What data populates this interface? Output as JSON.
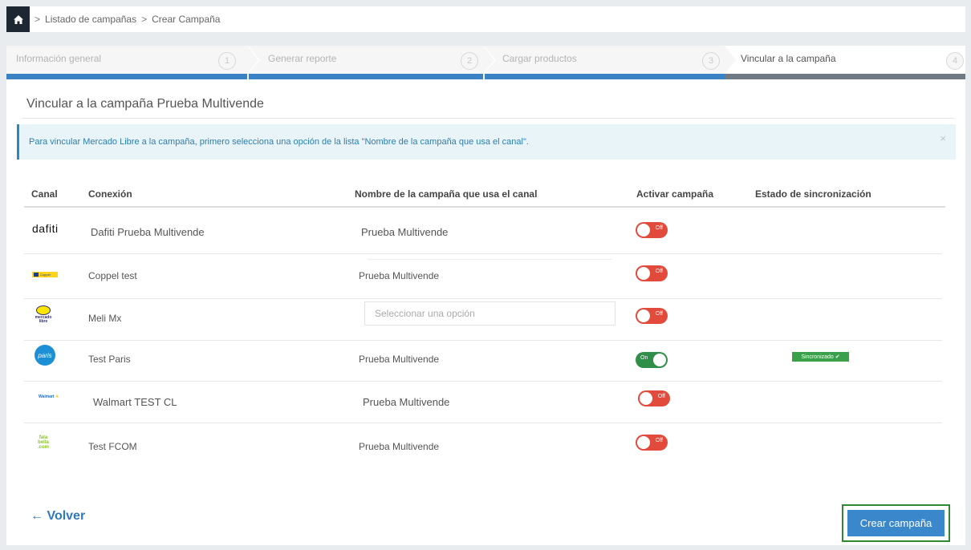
{
  "breadcrumb": {
    "items": [
      "Listado de campañas",
      "Crear Campaña"
    ],
    "separator": ">"
  },
  "stepper": {
    "steps": [
      {
        "label": "Información general",
        "num": "1"
      },
      {
        "label": "Generar reporte",
        "num": "2"
      },
      {
        "label": "Cargar productos",
        "num": "3"
      },
      {
        "label": "Vincular a la campaña",
        "num": "4"
      }
    ],
    "active_step": 4
  },
  "card": {
    "title": "Vincular a la campaña Prueba Multivende",
    "alert": "Para vincular Mercado Libre a la campaña, primero selecciona una opción de la lista \"Nombre de la campaña que usa el canal\".",
    "alert_close": "×"
  },
  "table": {
    "headers": [
      "Canal",
      "Conexión",
      "Nombre de la campaña que usa el canal",
      "Activar campaña",
      "Estado de sincronización"
    ],
    "rows": [
      {
        "logo_text": "dafiti",
        "conexion": "Dafiti Prueba Multivende",
        "campaign": "Prueba Multivende",
        "toggle": "Off",
        "sync": ""
      },
      {
        "logo_text": "Coppel",
        "conexion": "Coppel test",
        "campaign": "Prueba Multivende",
        "toggle": "Off",
        "sync": ""
      },
      {
        "logo_text": "mercado libre",
        "conexion": "Meli Mx",
        "campaign": "",
        "select_placeholder": "Seleccionar una opción",
        "toggle": "Off",
        "sync": ""
      },
      {
        "logo_text": "paris",
        "conexion": "Test Paris",
        "campaign": "Prueba Multivende",
        "toggle": "On",
        "sync": "Sincronizado ✔"
      },
      {
        "logo_text": "Walmart",
        "conexion": "Walmart TEST CL",
        "campaign": "Prueba Multivende",
        "toggle": "Off",
        "sync": ""
      },
      {
        "logo_text": "fala bella .com",
        "conexion": "Test FCOM",
        "campaign": "Prueba Multivende",
        "toggle": "Off",
        "sync": ""
      }
    ]
  },
  "actions": {
    "back_label": "Volver",
    "create_label": "Crear campaña"
  },
  "colors": {
    "accent": "#3b87cc",
    "toggle_off": "#e24b3b",
    "toggle_on": "#2f8f49",
    "alert_text": "#2a7fb0"
  }
}
